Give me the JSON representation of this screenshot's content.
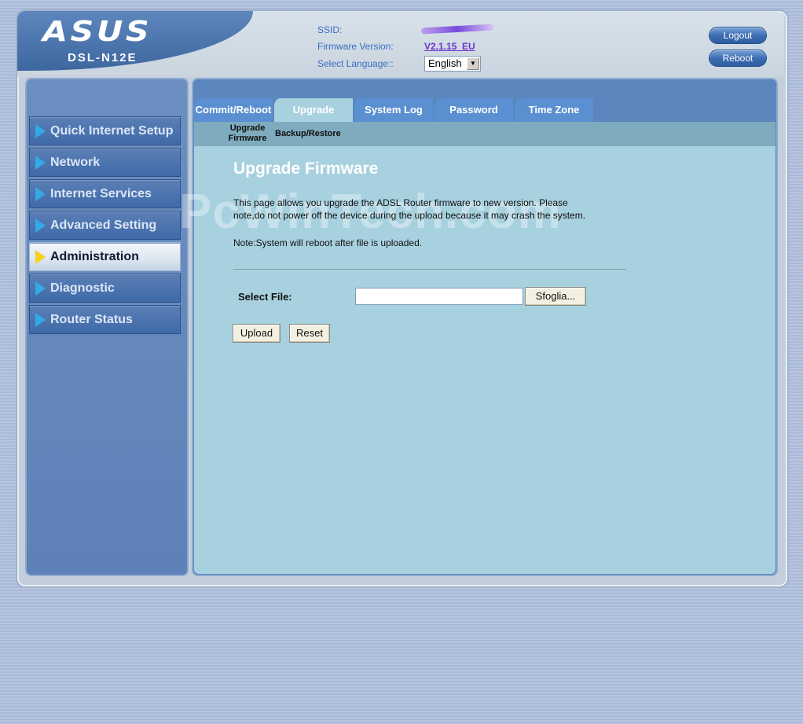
{
  "header": {
    "brand": "ASUS",
    "model": "DSL-N12E",
    "ssid_label": "SSID:",
    "firmware_label": "Firmware Version:",
    "firmware_value": "V2.1.15_EU",
    "language_label": "Select Language::",
    "language_value": "English",
    "logout_label": "Logout",
    "reboot_label": "Reboot"
  },
  "sidebar": {
    "items": [
      {
        "label": "Quick Internet Setup"
      },
      {
        "label": "Network"
      },
      {
        "label": "Internet Services"
      },
      {
        "label": "Advanced Setting"
      },
      {
        "label": "Administration"
      },
      {
        "label": "Diagnostic"
      },
      {
        "label": "Router Status"
      }
    ],
    "active": "Administration"
  },
  "tabs": [
    {
      "label": "Commit/Reboot"
    },
    {
      "label": "Upgrade"
    },
    {
      "label": "System Log"
    },
    {
      "label": "Password"
    },
    {
      "label": "Time Zone"
    }
  ],
  "active_tab": "Upgrade",
  "subtabs": [
    {
      "label": "Upgrade Firmware"
    },
    {
      "label": "Backup/Restore"
    }
  ],
  "main": {
    "title": "Upgrade Firmware",
    "description_line1": "This page allows you upgrade the ADSL Router firmware to new version. Please",
    "description_line2": "note,do not power off the device during the upload because it may crash the system.",
    "note": "Note:System will reboot after file is uploaded.",
    "select_file_label": "Select File:",
    "file_value": "",
    "browse_label": "Sfoglia...",
    "upload_label": "Upload",
    "reset_label": "Reset"
  },
  "watermark": "PcWinTech.com",
  "colors": {
    "accent_blue": "#5a8fd1",
    "content_bg": "#a8d1df",
    "active_arrow": "#f2d21e",
    "menu_arrow": "#35a8e6",
    "firmware_link": "#6b33c9"
  },
  "icons": {
    "menu_arrow": "triangle-right-icon",
    "select_arrow": "chevron-down-icon"
  }
}
